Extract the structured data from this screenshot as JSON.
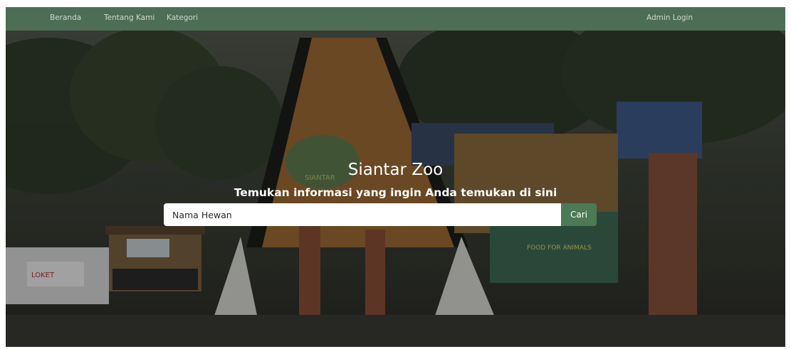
{
  "navbar": {
    "links": [
      {
        "label": "Beranda"
      },
      {
        "label": "Tentang Kami"
      },
      {
        "label": "Kategori"
      }
    ],
    "admin_label": "Admin Login"
  },
  "hero": {
    "title": "Siantar Zoo",
    "subtitle": "Temukan informasi yang ingin Anda temukan di sini",
    "background_signs": {
      "ticket_booth": "LOKET",
      "gate_sign": "SIANTAR",
      "banner": "FOOD FOR ANIMALS"
    }
  },
  "search": {
    "placeholder": "Nama Hewan",
    "button_label": "Cari"
  },
  "colors": {
    "navbar": "#4d6e55",
    "button": "#4d7a54"
  }
}
